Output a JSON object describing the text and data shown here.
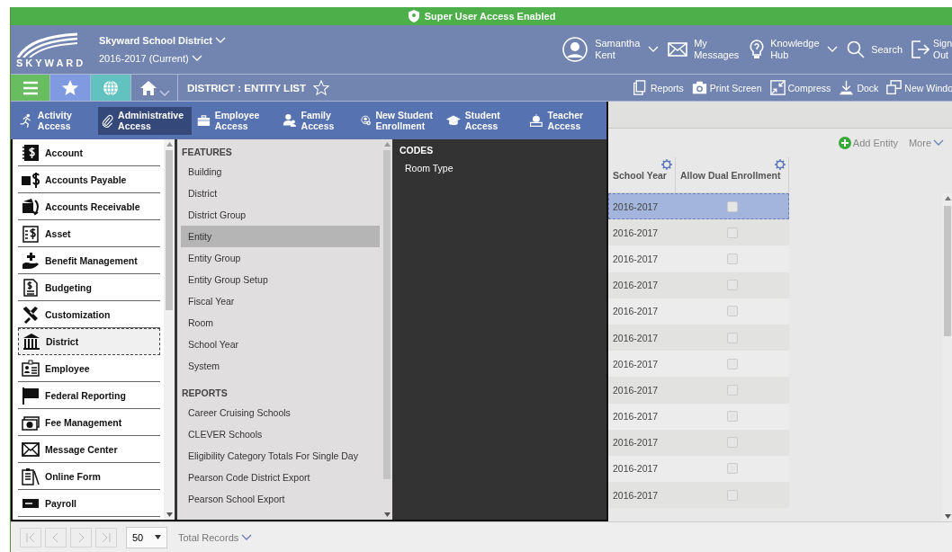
{
  "banner": {
    "text": "Super User Access Enabled"
  },
  "header": {
    "district": "Skyward School District",
    "year": "2016-2017 (Current)",
    "logo_text": "SKYWARD",
    "actions": [
      {
        "kind": "user",
        "label": "Samantha Kent",
        "dropdown": true
      },
      {
        "kind": "messages",
        "label": "My Messages",
        "dropdown": false
      },
      {
        "kind": "help",
        "label": "Knowledge Hub",
        "dropdown": true
      },
      {
        "kind": "search",
        "label": "Search",
        "dropdown": false
      },
      {
        "kind": "signout",
        "label": "Sign Out",
        "dropdown": false
      }
    ]
  },
  "toolbar": {
    "quick": [
      {
        "kind": "menu"
      },
      {
        "kind": "favorites"
      },
      {
        "kind": "globe"
      },
      {
        "kind": "home"
      }
    ],
    "title": "DISTRICT : ENTITY LIST",
    "actions": [
      {
        "kind": "reports",
        "label": "Reports"
      },
      {
        "kind": "print",
        "label": "Print Screen"
      },
      {
        "kind": "compress",
        "label": "Compress"
      },
      {
        "kind": "dock",
        "label": "Dock"
      },
      {
        "kind": "window",
        "label": "New Windo"
      }
    ]
  },
  "modules": [
    {
      "kind": "activity",
      "label": "Activity Access",
      "selected": false
    },
    {
      "kind": "admin",
      "label": "Administrative Access",
      "selected": true
    },
    {
      "kind": "employee",
      "label": "Employee Access",
      "selected": false
    },
    {
      "kind": "family",
      "label": "Family Access",
      "selected": false
    },
    {
      "kind": "enroll",
      "label": "New Student Enrollment",
      "selected": false
    },
    {
      "kind": "student",
      "label": "Student Access",
      "selected": false
    },
    {
      "kind": "teacher",
      "label": "Teacher Access",
      "selected": false
    }
  ],
  "areas": [
    {
      "kind": "account",
      "label": "Account",
      "selected": false
    },
    {
      "kind": "payable",
      "label": "Accounts Payable",
      "selected": false
    },
    {
      "kind": "receivable",
      "label": "Accounts Receivable",
      "selected": false
    },
    {
      "kind": "asset",
      "label": "Asset",
      "selected": false
    },
    {
      "kind": "benefit",
      "label": "Benefit Management",
      "selected": false
    },
    {
      "kind": "budget",
      "label": "Budgeting",
      "selected": false
    },
    {
      "kind": "custom",
      "label": "Customization",
      "selected": false
    },
    {
      "kind": "district",
      "label": "District",
      "selected": true
    },
    {
      "kind": "employee",
      "label": "Employee",
      "selected": false
    },
    {
      "kind": "flag",
      "label": "Federal Reporting",
      "selected": false
    },
    {
      "kind": "fee",
      "label": "Fee Management",
      "selected": false
    },
    {
      "kind": "mail",
      "label": "Message Center",
      "selected": false
    },
    {
      "kind": "form",
      "label": "Online Form",
      "selected": false
    },
    {
      "kind": "payroll",
      "label": "Payroll",
      "selected": false
    }
  ],
  "feature_sections": [
    {
      "heading": "FEATURES",
      "items": [
        {
          "label": "Building",
          "selected": false
        },
        {
          "label": "District",
          "selected": false
        },
        {
          "label": "District Group",
          "selected": false
        },
        {
          "label": "Entity",
          "selected": true
        },
        {
          "label": "Entity Group",
          "selected": false
        },
        {
          "label": "Entity Group Setup",
          "selected": false
        },
        {
          "label": "Fiscal Year",
          "selected": false
        },
        {
          "label": "Room",
          "selected": false
        },
        {
          "label": "School Year",
          "selected": false
        },
        {
          "label": "System",
          "selected": false
        }
      ]
    },
    {
      "heading": "REPORTS",
      "items": [
        {
          "label": "Career Cruising Schools",
          "selected": false
        },
        {
          "label": "CLEVER Schools",
          "selected": false
        },
        {
          "label": "Eligibility Category Totals For Single Day",
          "selected": false
        },
        {
          "label": "Pearson Code District Export",
          "selected": false
        },
        {
          "label": "Pearson School Export",
          "selected": false
        }
      ]
    }
  ],
  "codes": {
    "heading": "CODES",
    "items": [
      "Room Type"
    ]
  },
  "content": {
    "actions": [
      {
        "kind": "add",
        "label": "Add Entity"
      },
      {
        "kind": "more",
        "label": "More"
      }
    ],
    "table": {
      "columns": [
        "School Year",
        "Allow Dual Enrollment"
      ],
      "rows": [
        {
          "school_year": "2016-2017",
          "allow_dual": false,
          "selected": true
        },
        {
          "school_year": "2016-2017",
          "allow_dual": false,
          "selected": false
        },
        {
          "school_year": "2016-2017",
          "allow_dual": false,
          "selected": false
        },
        {
          "school_year": "2016-2017",
          "allow_dual": false,
          "selected": false
        },
        {
          "school_year": "2016-2017",
          "allow_dual": false,
          "selected": false
        },
        {
          "school_year": "2016-2017",
          "allow_dual": false,
          "selected": false
        },
        {
          "school_year": "2016-2017",
          "allow_dual": false,
          "selected": false
        },
        {
          "school_year": "2016-2017",
          "allow_dual": false,
          "selected": false
        },
        {
          "school_year": "2016-2017",
          "allow_dual": false,
          "selected": false
        },
        {
          "school_year": "2016-2017",
          "allow_dual": false,
          "selected": false
        },
        {
          "school_year": "2016-2017",
          "allow_dual": false,
          "selected": false
        },
        {
          "school_year": "2016-2017",
          "allow_dual": false,
          "selected": false
        }
      ]
    }
  },
  "footer": {
    "page_size": "50",
    "total_label": "Total Records"
  }
}
